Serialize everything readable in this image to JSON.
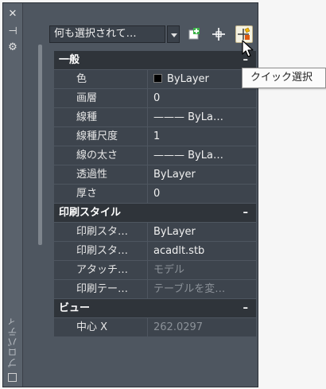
{
  "titlebar": {
    "palette_title": "プロパティ",
    "close_glyph": "✕",
    "autohide_glyph": "⊣",
    "settings_glyph": "⚙"
  },
  "toolbar": {
    "selection_value": "何も選択されて…"
  },
  "tooltip": {
    "text": "クイック選択"
  },
  "categories": {
    "general": {
      "title": "一般",
      "toggle": "–",
      "rows": [
        {
          "name": "色",
          "value": "ByLayer"
        },
        {
          "name": "画層",
          "value": "0"
        },
        {
          "name": "線種",
          "value": "——— ByLa…"
        },
        {
          "name": "線種尺度",
          "value": "1"
        },
        {
          "name": "線の太さ",
          "value": "——— ByLa…"
        },
        {
          "name": "透過性",
          "value": "ByLayer"
        },
        {
          "name": "厚さ",
          "value": "0"
        }
      ]
    },
    "plotstyle": {
      "title": "印刷スタイル",
      "toggle": "–",
      "rows": [
        {
          "name": "印刷スタ…",
          "value": "ByLayer"
        },
        {
          "name": "印刷スタ…",
          "value": "acadlt.stb"
        },
        {
          "name": "アタッチ…",
          "value": "モデル"
        },
        {
          "name": "印刷テー…",
          "value": "テーブルを変…"
        }
      ]
    },
    "view": {
      "title": "ビュー",
      "toggle": "–",
      "rows": [
        {
          "name": "中心 X",
          "value": "262.0297"
        }
      ]
    }
  },
  "colors": {
    "panel_bg": "#4e5660",
    "row_bg": "#3d444d",
    "category_bg": "#2f343a",
    "dim_text": "#8b9198"
  }
}
